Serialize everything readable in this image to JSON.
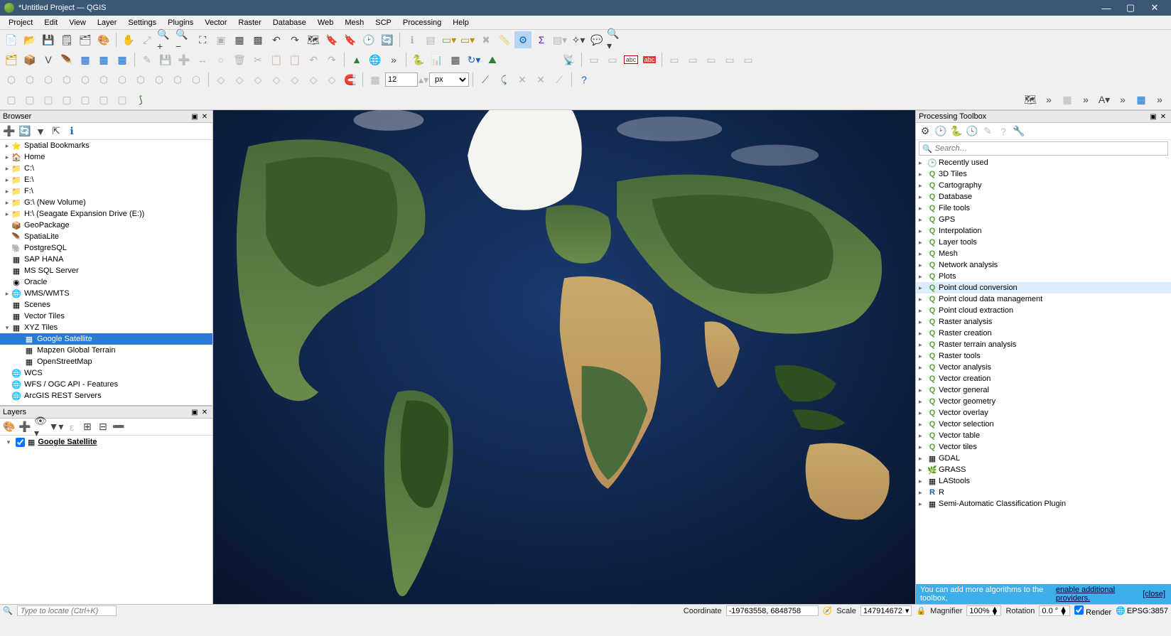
{
  "window": {
    "title": "*Untitled Project — QGIS"
  },
  "menus": [
    "Project",
    "Edit",
    "View",
    "Layer",
    "Settings",
    "Plugins",
    "Vector",
    "Raster",
    "Database",
    "Web",
    "Mesh",
    "SCP",
    "Processing",
    "Help"
  ],
  "toolbar": {
    "size_value": "12",
    "size_unit": "px"
  },
  "browser": {
    "title": "Browser",
    "items": [
      {
        "label": "Spatial Bookmarks",
        "icon": "⭐",
        "arrow": "▸"
      },
      {
        "label": "Home",
        "icon": "🏠",
        "arrow": "▸"
      },
      {
        "label": "C:\\",
        "icon": "📁",
        "arrow": "▸"
      },
      {
        "label": "E:\\",
        "icon": "📁",
        "arrow": "▸"
      },
      {
        "label": "F:\\",
        "icon": "📁",
        "arrow": "▸"
      },
      {
        "label": "G:\\ (New Volume)",
        "icon": "📁",
        "arrow": "▸"
      },
      {
        "label": "H:\\ (Seagate Expansion Drive (E:))",
        "icon": "📁",
        "arrow": "▸"
      },
      {
        "label": "GeoPackage",
        "icon": "📦",
        "arrow": ""
      },
      {
        "label": "SpatiaLite",
        "icon": "🪶",
        "arrow": ""
      },
      {
        "label": "PostgreSQL",
        "icon": "🐘",
        "arrow": ""
      },
      {
        "label": "SAP HANA",
        "icon": "▦",
        "arrow": ""
      },
      {
        "label": "MS SQL Server",
        "icon": "▦",
        "arrow": ""
      },
      {
        "label": "Oracle",
        "icon": "◉",
        "arrow": ""
      },
      {
        "label": "WMS/WMTS",
        "icon": "🌐",
        "arrow": "▸"
      },
      {
        "label": "Scenes",
        "icon": "▦",
        "arrow": ""
      },
      {
        "label": "Vector Tiles",
        "icon": "▦",
        "arrow": ""
      },
      {
        "label": "XYZ Tiles",
        "icon": "▦",
        "arrow": "▾",
        "expanded": true,
        "children": [
          {
            "label": "Google Satellite",
            "icon": "▦",
            "selected": true
          },
          {
            "label": "Mapzen Global Terrain",
            "icon": "▦"
          },
          {
            "label": "OpenStreetMap",
            "icon": "▦"
          }
        ]
      },
      {
        "label": "WCS",
        "icon": "🌐",
        "arrow": ""
      },
      {
        "label": "WFS / OGC API - Features",
        "icon": "🌐",
        "arrow": ""
      },
      {
        "label": "ArcGIS REST Servers",
        "icon": "🌐",
        "arrow": ""
      }
    ]
  },
  "layers": {
    "title": "Layers",
    "items": [
      {
        "label": "Google Satellite",
        "checked": true
      }
    ]
  },
  "processing": {
    "title": "Processing Toolbox",
    "search_placeholder": "Search…",
    "groups": [
      {
        "label": "Recently used",
        "icon": "🕑"
      },
      {
        "label": "3D Tiles",
        "icon": "Q"
      },
      {
        "label": "Cartography",
        "icon": "Q"
      },
      {
        "label": "Database",
        "icon": "Q"
      },
      {
        "label": "File tools",
        "icon": "Q"
      },
      {
        "label": "GPS",
        "icon": "Q"
      },
      {
        "label": "Interpolation",
        "icon": "Q"
      },
      {
        "label": "Layer tools",
        "icon": "Q"
      },
      {
        "label": "Mesh",
        "icon": "Q"
      },
      {
        "label": "Network analysis",
        "icon": "Q"
      },
      {
        "label": "Plots",
        "icon": "Q"
      },
      {
        "label": "Point cloud conversion",
        "icon": "Q",
        "hovered": true
      },
      {
        "label": "Point cloud data management",
        "icon": "Q"
      },
      {
        "label": "Point cloud extraction",
        "icon": "Q"
      },
      {
        "label": "Raster analysis",
        "icon": "Q"
      },
      {
        "label": "Raster creation",
        "icon": "Q"
      },
      {
        "label": "Raster terrain analysis",
        "icon": "Q"
      },
      {
        "label": "Raster tools",
        "icon": "Q"
      },
      {
        "label": "Vector analysis",
        "icon": "Q"
      },
      {
        "label": "Vector creation",
        "icon": "Q"
      },
      {
        "label": "Vector general",
        "icon": "Q"
      },
      {
        "label": "Vector geometry",
        "icon": "Q"
      },
      {
        "label": "Vector overlay",
        "icon": "Q"
      },
      {
        "label": "Vector selection",
        "icon": "Q"
      },
      {
        "label": "Vector table",
        "icon": "Q"
      },
      {
        "label": "Vector tiles",
        "icon": "Q"
      },
      {
        "label": "GDAL",
        "icon": "▦"
      },
      {
        "label": "GRASS",
        "icon": "🌿"
      },
      {
        "label": "LAStools",
        "icon": "▦"
      },
      {
        "label": "R",
        "icon": "R"
      },
      {
        "label": "Semi-Automatic Classification Plugin",
        "icon": "▦"
      }
    ],
    "hint_prefix": "You can add more algorithms to the toolbox,",
    "hint_link": "enable additional providers.",
    "hint_close": "[close]"
  },
  "status": {
    "locator_placeholder": "Type to locate (Ctrl+K)",
    "coordinate_label": "Coordinate",
    "coordinate_value": "-19763558, 6848758",
    "scale_label": "Scale",
    "scale_value": "147914672",
    "magnifier_label": "Magnifier",
    "magnifier_value": "100%",
    "rotation_label": "Rotation",
    "rotation_value": "0.0 °",
    "render_label": "Render",
    "epsg": "EPSG:3857"
  }
}
